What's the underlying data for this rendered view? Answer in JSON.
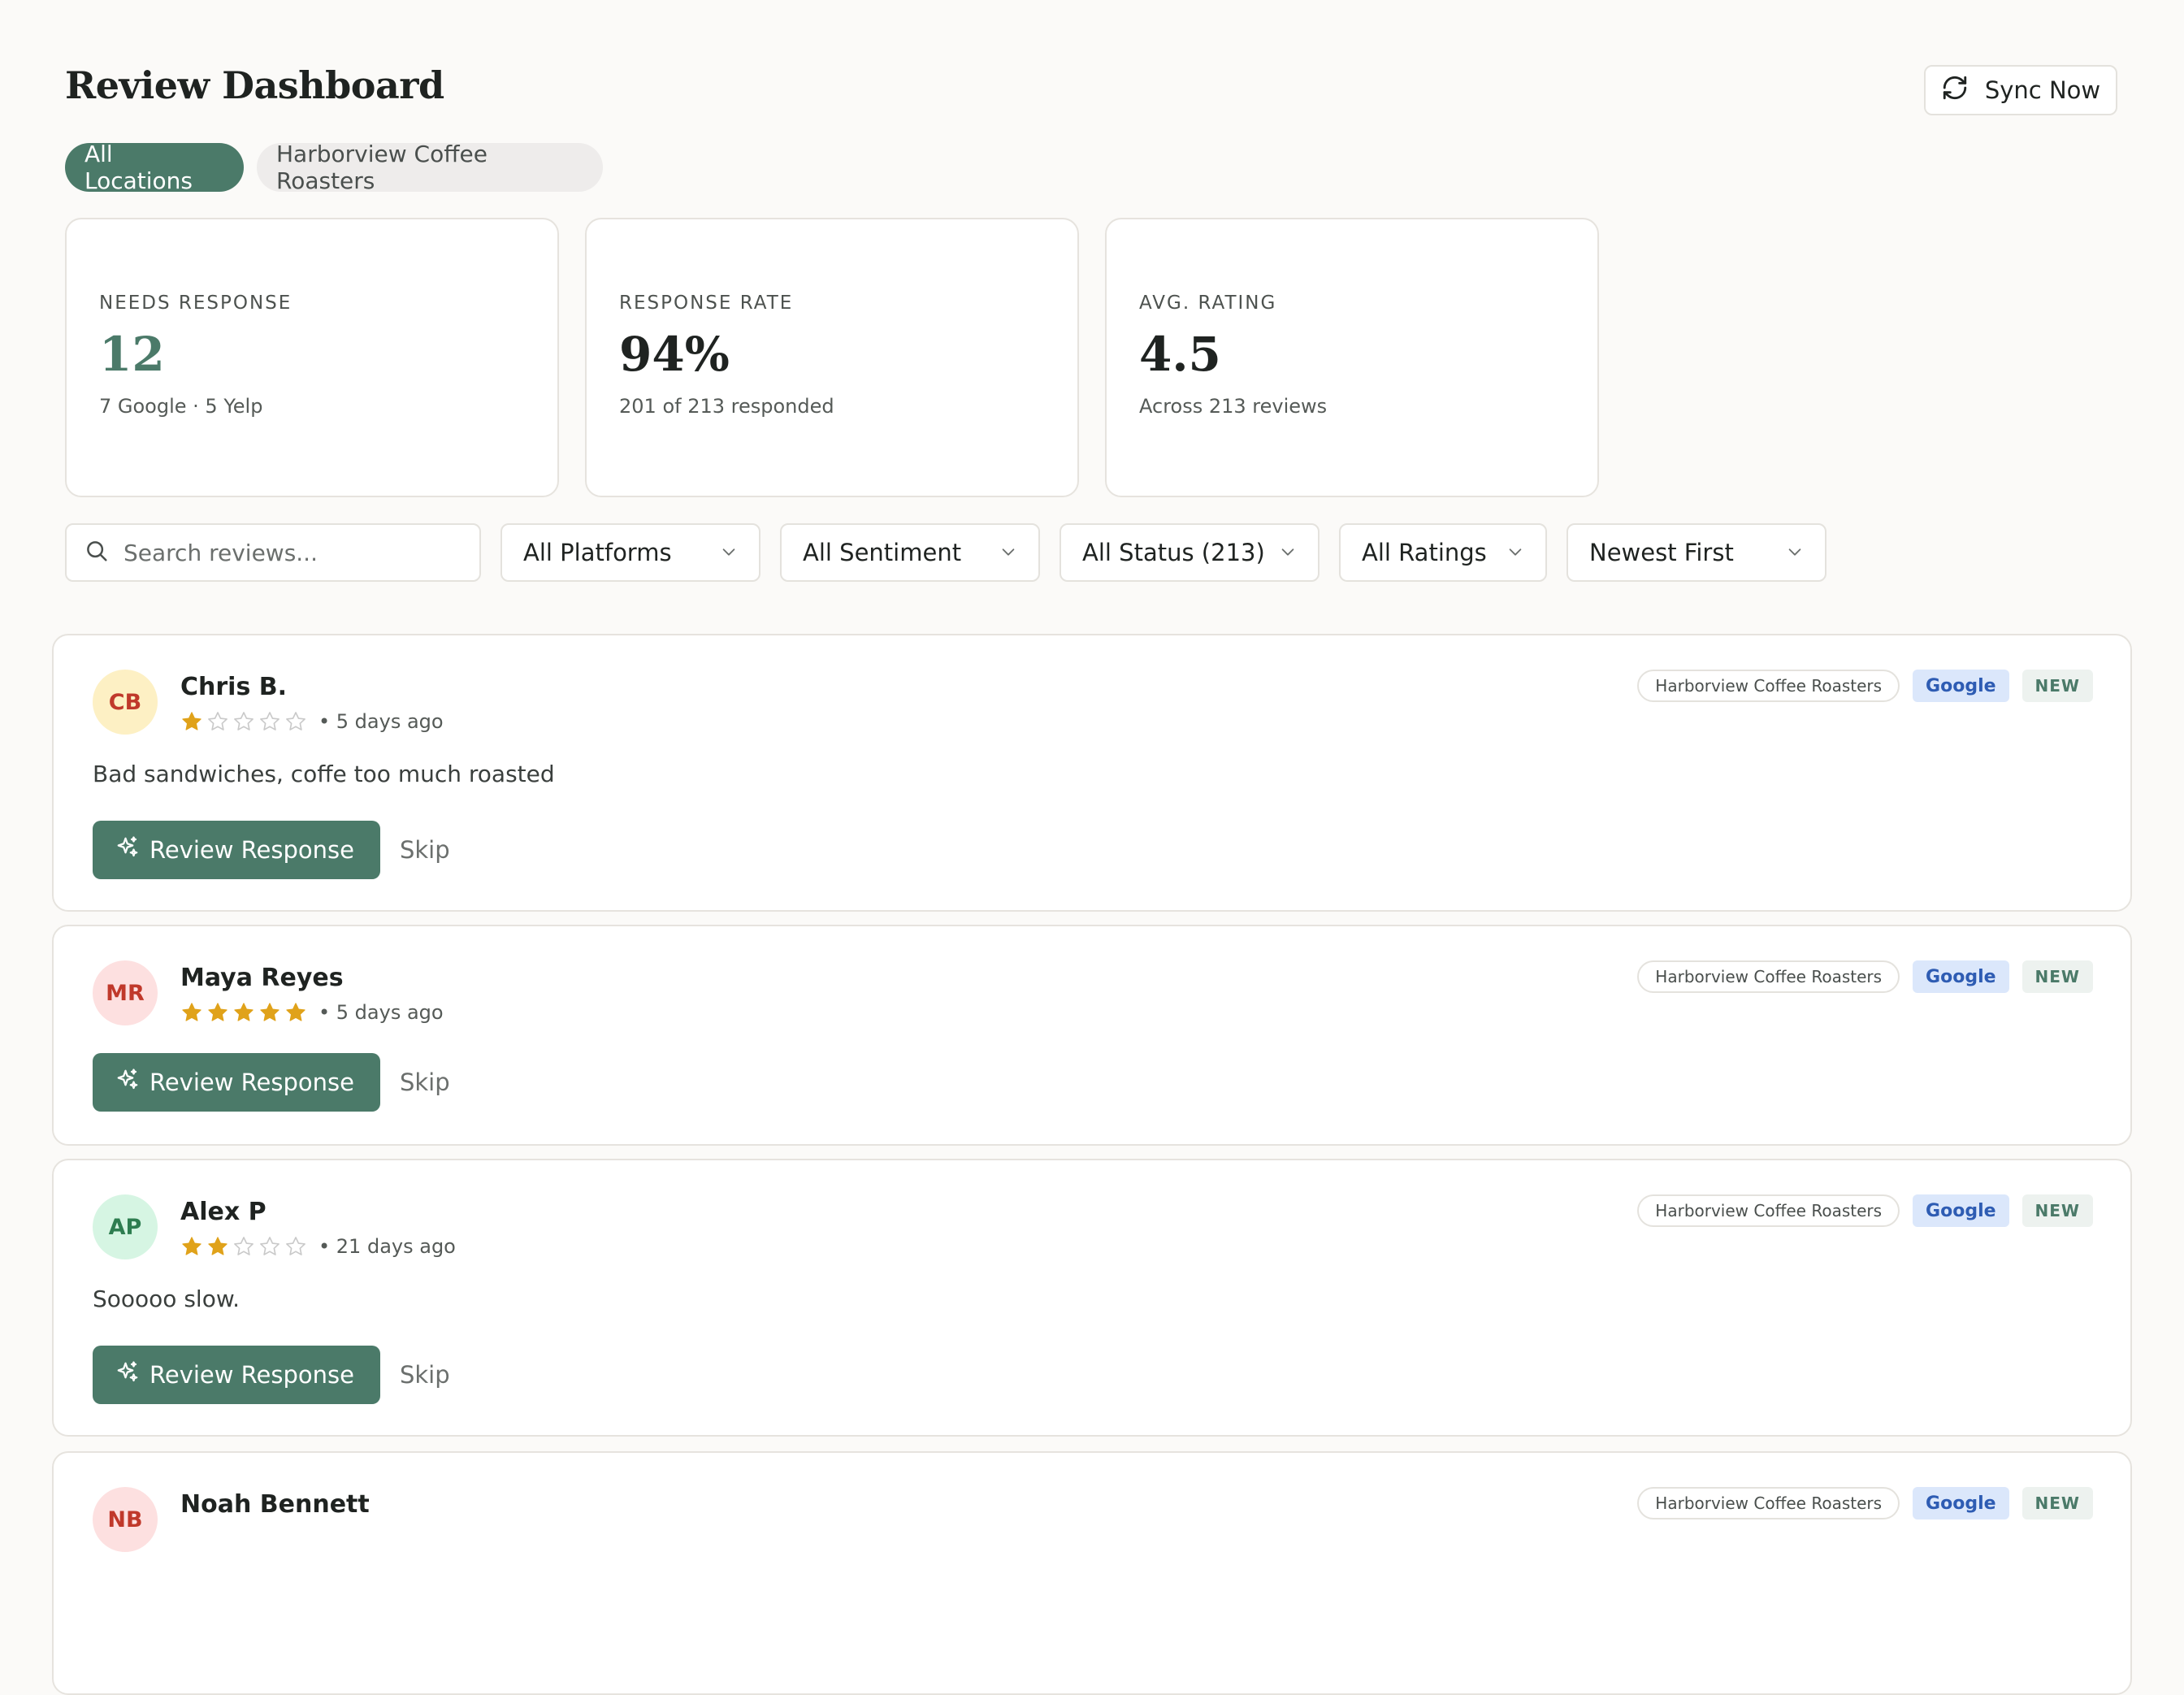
{
  "header": {
    "title": "Review Dashboard",
    "sync_label": "Sync Now"
  },
  "locations": [
    {
      "label": "All Locations",
      "active": true
    },
    {
      "label": "Harborview Coffee Roasters",
      "active": false
    }
  ],
  "stats": [
    {
      "label": "NEEDS RESPONSE",
      "value": "12",
      "sub": "7 Google · 5 Yelp"
    },
    {
      "label": "RESPONSE RATE",
      "value": "94%",
      "sub": "201 of 213 responded"
    },
    {
      "label": "AVG. RATING",
      "value": "4.5",
      "sub": "Across 213 reviews"
    }
  ],
  "filters": {
    "search_placeholder": "Search reviews...",
    "platform": "All Platforms",
    "sentiment": "All Sentiment",
    "status": "All Status (213)",
    "ratings": "All Ratings",
    "sort": "Newest First"
  },
  "reviews": [
    {
      "initials": "CB",
      "name": "Chris B.",
      "rating": 1,
      "time": "• 5 days ago",
      "text": "Bad sandwiches, coffe too much roasted",
      "location": "Harborview Coffee Roasters",
      "platform": "Google",
      "badge": "NEW",
      "action": "Review Response",
      "skip": "Skip"
    },
    {
      "initials": "MR",
      "name": "Maya Reyes",
      "rating": 5,
      "time": "• 5 days ago",
      "text": "",
      "location": "Harborview Coffee Roasters",
      "platform": "Google",
      "badge": "NEW",
      "action": "Review Response",
      "skip": "Skip"
    },
    {
      "initials": "AP",
      "name": "Alex P",
      "rating": 2,
      "time": "• 21 days ago",
      "text": "Sooooo slow.",
      "location": "Harborview Coffee Roasters",
      "platform": "Google",
      "badge": "NEW",
      "action": "Review Response",
      "skip": "Skip"
    },
    {
      "initials": "NB",
      "name": "Noah Bennett",
      "location": "Harborview Coffee Roasters",
      "platform": "Google",
      "badge": "NEW"
    }
  ],
  "colors": {
    "accent": "#4b7a69",
    "star_filled": "#e0a21a",
    "star_empty": "#c9c9c9",
    "background": "#fbfaf8"
  },
  "avatar_colors": [
    {
      "bg": "#fdf0c4",
      "fg": "#c0392b"
    },
    {
      "bg": "#fde0e0",
      "fg": "#c0392b"
    },
    {
      "bg": "#d6f5e3",
      "fg": "#2e7d50"
    },
    {
      "bg": "#fde0e0",
      "fg": "#c0392b"
    }
  ]
}
